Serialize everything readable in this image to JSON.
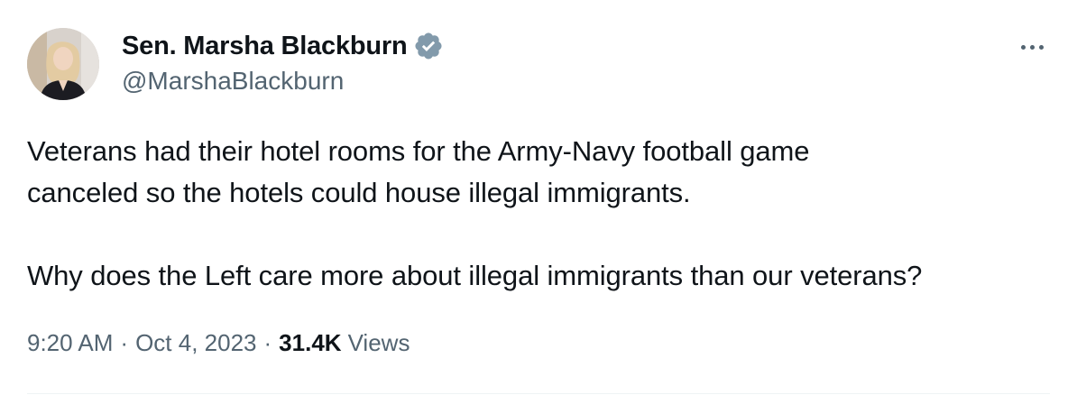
{
  "author": {
    "display_name": "Sen. Marsha Blackburn",
    "handle": "@MarshaBlackburn",
    "verified": true,
    "verified_icon": "verified-badge-icon",
    "verified_color": "#829aab"
  },
  "tweet": {
    "paragraph_1_line_1": "Veterans had their hotel rooms for the Army-Navy football game",
    "paragraph_1_line_2": "canceled so the hotels could house illegal immigrants.",
    "paragraph_2": "Why does the Left care more about illegal immigrants than our veterans?"
  },
  "meta": {
    "time": "9:20 AM",
    "separator": "·",
    "date": "Oct 4, 2023",
    "views_count": "31.4K",
    "views_label": "Views"
  },
  "colors": {
    "text_primary": "#0f1419",
    "text_secondary": "#536471",
    "divider": "#eff3f4"
  },
  "more_menu_icon": "more-horizontal-icon"
}
